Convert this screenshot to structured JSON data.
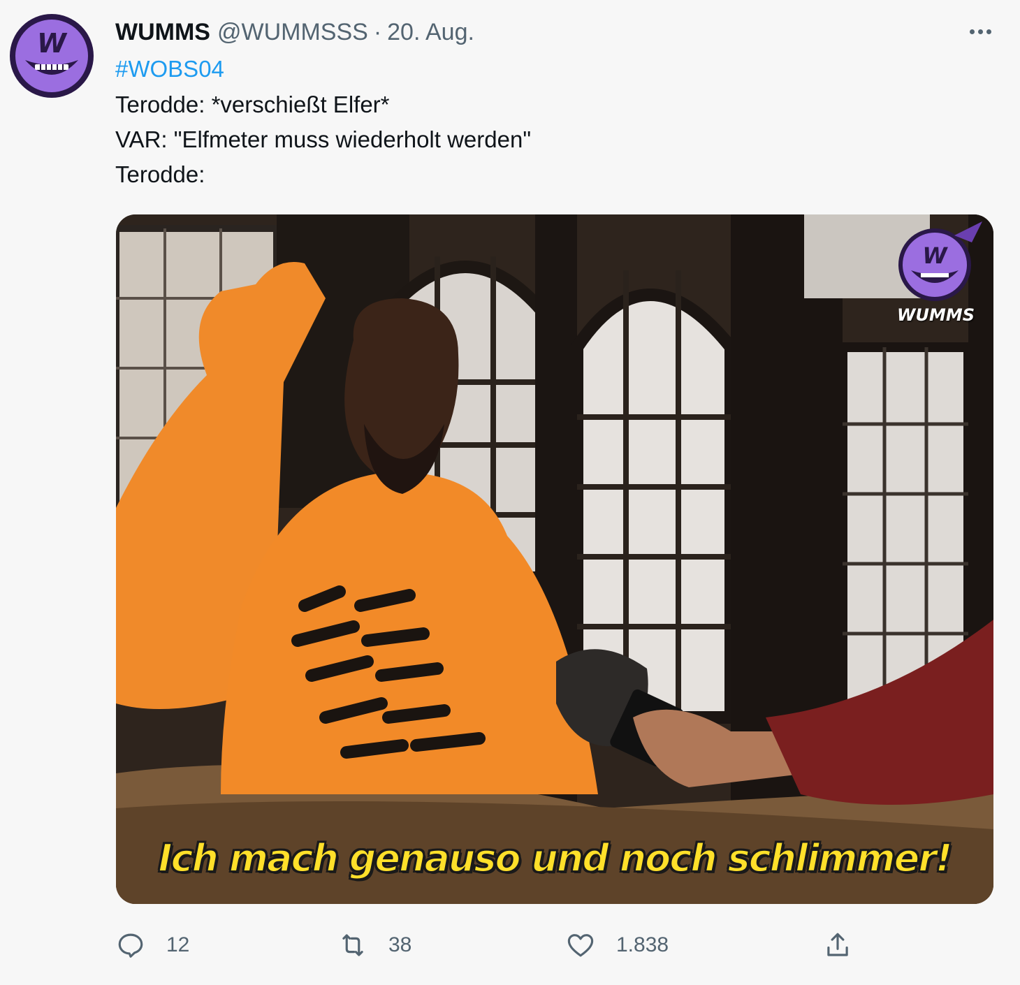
{
  "author": {
    "display_name": "WUMMS",
    "handle": "@WUMMSSS",
    "separator": "·",
    "date": "20. Aug."
  },
  "tweet": {
    "hashtag": "#WOBS04",
    "lines": [
      "Terodde: *verschießt Elfer*",
      "VAR: \"Elfmeter muss wiederholt werden\"",
      "Terodde:"
    ]
  },
  "media": {
    "subtitle": "Ich mach genauso und noch schlimmer!",
    "watermark_label": "WUMMS",
    "watermark_letter": "W",
    "avatar_letter": "W"
  },
  "actions": {
    "reply_count": "12",
    "retweet_count": "38",
    "like_count": "1.838"
  },
  "icons": [
    "more-icon",
    "reply-icon",
    "retweet-icon",
    "like-icon",
    "share-icon"
  ],
  "colors": {
    "brand_purple": "#9b6ee0",
    "link_blue": "#1d9bf0",
    "secondary_text": "#536471",
    "subtitle_yellow": "#ffe02a"
  }
}
